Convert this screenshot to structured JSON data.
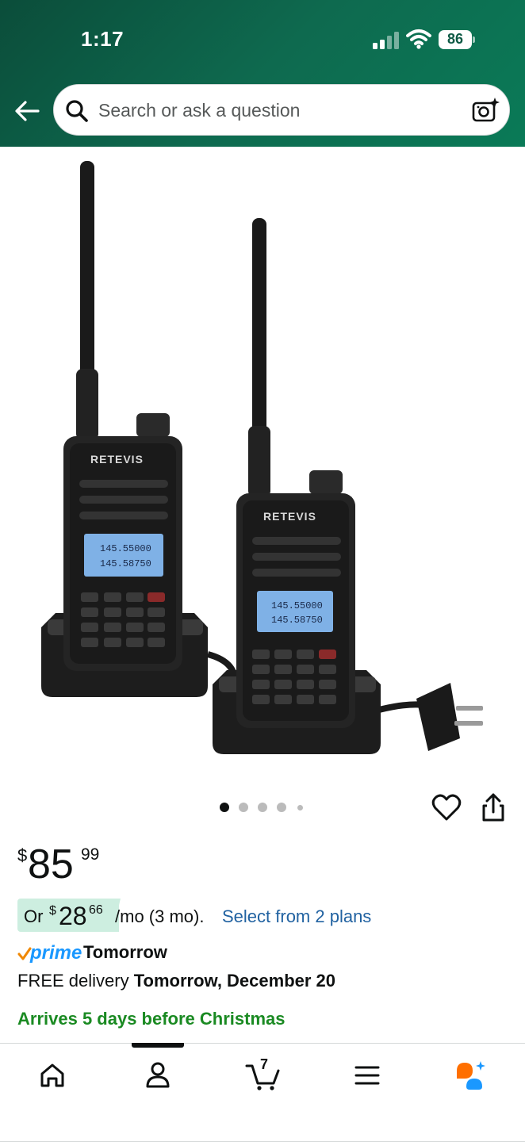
{
  "status_bar": {
    "time": "1:17",
    "battery": "86"
  },
  "search": {
    "placeholder": "Search or ask a question"
  },
  "product": {
    "image_alt": "Retevis two-way radio walkie talkies with charging docks",
    "brand_on_radio": "RETEVIS",
    "display_line1": "145.55000",
    "display_line2": "145.58750",
    "carousel_total": 5,
    "carousel_active": 1
  },
  "price": {
    "symbol": "$",
    "whole": "85",
    "fraction": "99"
  },
  "installment": {
    "prefix": "Or",
    "symbol": "$",
    "whole": "28",
    "fraction": "66",
    "terms": "/mo (3 mo).",
    "link": "Select from 2 plans"
  },
  "delivery": {
    "prime_label": "prime",
    "prime_day": "Tomorrow",
    "free_text": "FREE delivery",
    "date": "Tomorrow, December 20",
    "arrives": "Arrives 5 days before Christmas"
  },
  "nav": {
    "cart_count": "7",
    "items": [
      "home",
      "account",
      "cart",
      "menu",
      "rufus"
    ]
  },
  "colors": {
    "header": "#0e6a4f",
    "link": "#2162a1",
    "prime": "#1a98ff",
    "green_text": "#1a8a22",
    "installment_bg": "#cdeee0"
  }
}
